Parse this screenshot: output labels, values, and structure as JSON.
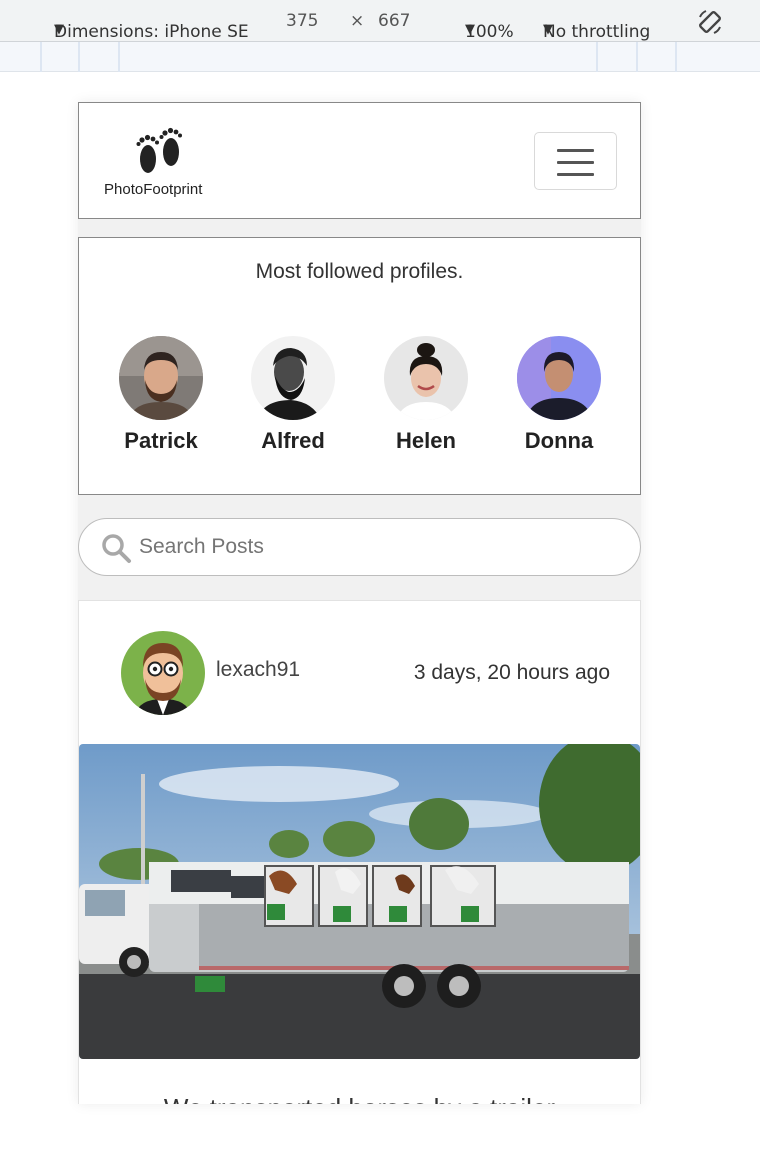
{
  "devtools": {
    "device": "Dimensions: iPhone SE",
    "width": "375",
    "times": "×",
    "height": "667",
    "zoom": "100%",
    "throttling": "No throttling",
    "caret": "▼"
  },
  "navbar": {
    "brand": "PhotoFootprint",
    "logo_icon": "footprints-icon",
    "menu_icon": "hamburger-menu-icon"
  },
  "profiles": {
    "title": "Most followed profiles.",
    "items": [
      {
        "name": "Patrick"
      },
      {
        "name": "Alfred"
      },
      {
        "name": "Helen"
      },
      {
        "name": "Donna"
      }
    ]
  },
  "search": {
    "placeholder": "Search Posts",
    "icon": "search-icon"
  },
  "post": {
    "username": "lexach91",
    "time": "3 days, 20 hours ago",
    "title": "We transported horses by a trailer"
  },
  "colors": {
    "page_bg": "#f1f1f1",
    "card_border": "#888888",
    "text": "#222222"
  }
}
